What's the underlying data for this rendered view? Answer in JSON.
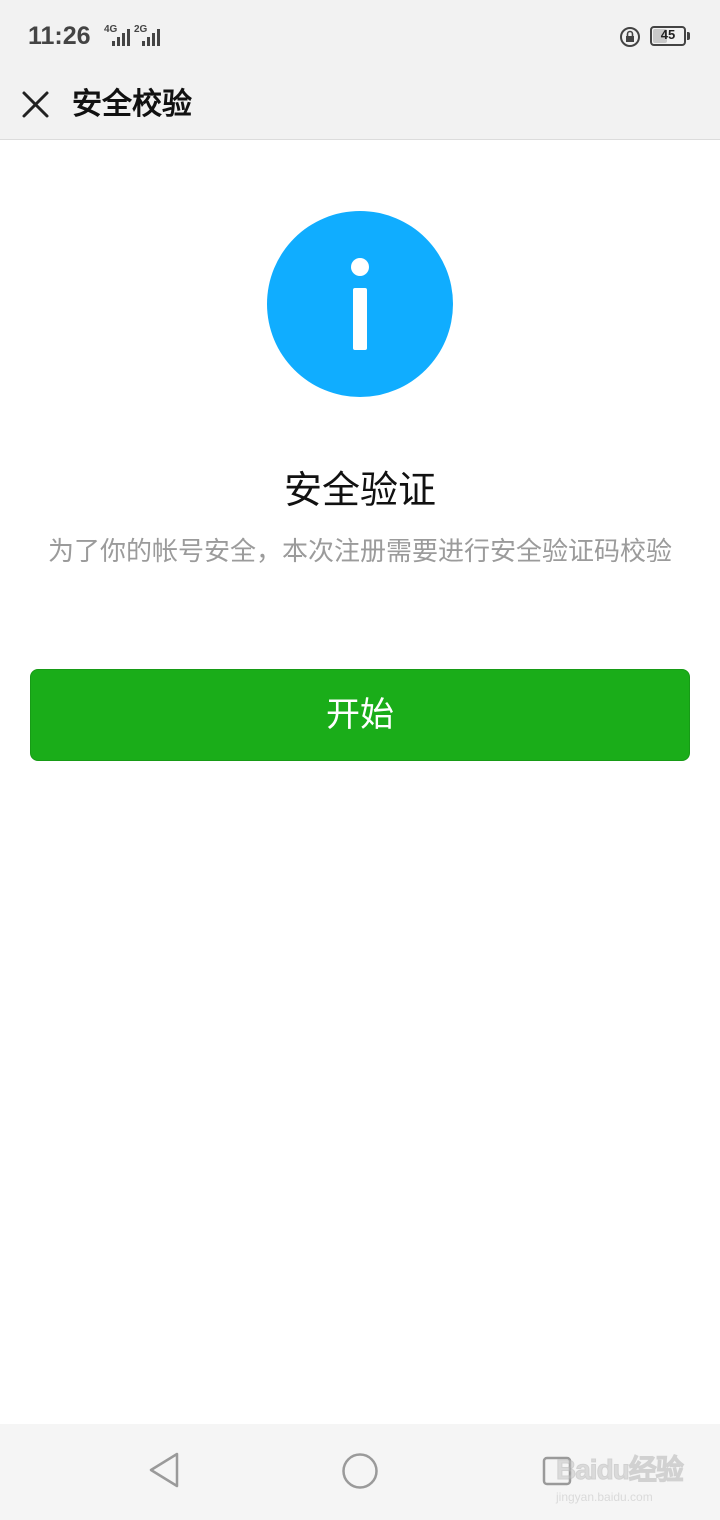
{
  "status_bar": {
    "time": "11:26",
    "network_1": "4G",
    "network_2": "2G",
    "battery_level": "45",
    "icons": [
      "signal-icon",
      "signal-icon",
      "rotation-lock-icon",
      "battery-icon"
    ]
  },
  "nav": {
    "close_icon": "close-icon",
    "title": "安全校验"
  },
  "content": {
    "icon": "info-icon",
    "icon_color": "#10adff",
    "heading": "安全验证",
    "description": "为了你的帐号安全，本次注册需要进行安全验证码校验",
    "start_button": "开始",
    "button_color": "#1aad19"
  },
  "system_nav": {
    "back_icon": "back-triangle-icon",
    "home_icon": "home-circle-icon",
    "recent_icon": "recent-apps-icon"
  },
  "watermark": {
    "brand": "Baidu经验",
    "url": "jingyan.baidu.com"
  }
}
